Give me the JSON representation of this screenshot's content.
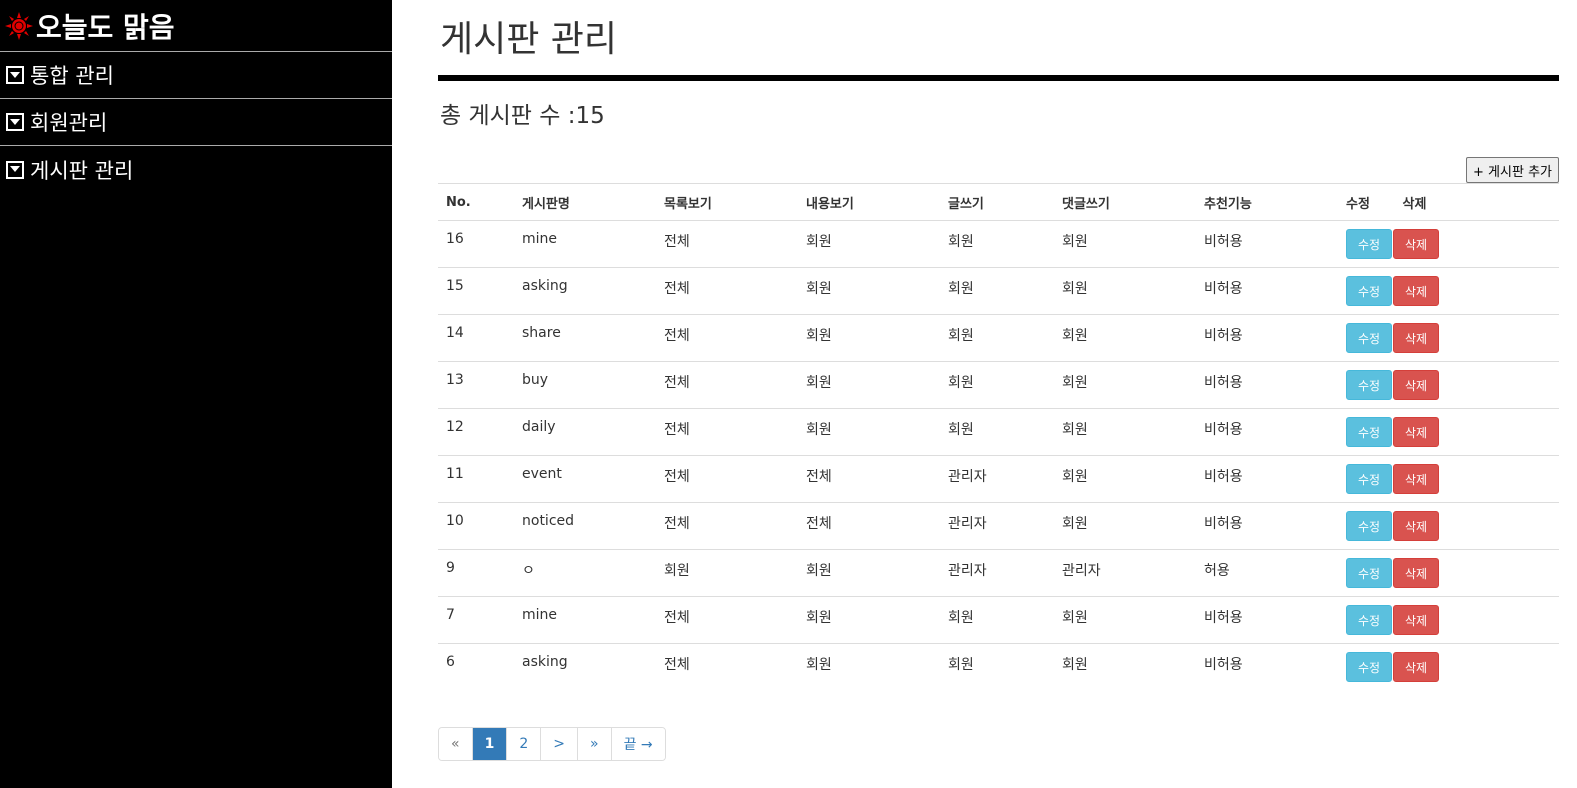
{
  "colors": {
    "sidebar_bg": "#000000",
    "edit_btn": "#5bc0de",
    "delete_btn": "#d9534f",
    "active_page": "#337ab7"
  },
  "brand": {
    "icon": "sun-icon",
    "name": "오늘도 맑음"
  },
  "sidebar": {
    "items": [
      {
        "label": "통합 관리",
        "icon": "caret-down-icon"
      },
      {
        "label": "회원관리",
        "icon": "caret-down-icon"
      },
      {
        "label": "게시판 관리",
        "icon": "caret-down-icon"
      }
    ]
  },
  "main": {
    "title": "게시판 관리",
    "count_label": "총 게시판 수 :15",
    "add_button": "+ 게시판 추가"
  },
  "table": {
    "headers": [
      "No.",
      "게시판명",
      "목록보기",
      "내용보기",
      "글쓰기",
      "댓글쓰기",
      "추천기능",
      "수정",
      "삭제"
    ],
    "edit_label": "수정",
    "delete_label": "삭제",
    "rows": [
      [
        "16",
        "mine",
        "전체",
        "회원",
        "회원",
        "회원",
        "비허용"
      ],
      [
        "15",
        "asking",
        "전체",
        "회원",
        "회원",
        "회원",
        "비허용"
      ],
      [
        "14",
        "share",
        "전체",
        "회원",
        "회원",
        "회원",
        "비허용"
      ],
      [
        "13",
        "buy",
        "전체",
        "회원",
        "회원",
        "회원",
        "비허용"
      ],
      [
        "12",
        "daily",
        "전체",
        "회원",
        "회원",
        "회원",
        "비허용"
      ],
      [
        "11",
        "event",
        "전체",
        "전체",
        "관리자",
        "회원",
        "비허용"
      ],
      [
        "10",
        "noticed",
        "전체",
        "전체",
        "관리자",
        "회원",
        "비허용"
      ],
      [
        "9",
        "ㅇ",
        "회원",
        "회원",
        "관리자",
        "관리자",
        "허용"
      ],
      [
        "7",
        "mine",
        "전체",
        "회원",
        "회원",
        "회원",
        "비허용"
      ],
      [
        "6",
        "asking",
        "전체",
        "회원",
        "회원",
        "회원",
        "비허용"
      ]
    ]
  },
  "pagination": {
    "items": [
      {
        "label": "«",
        "active": false
      },
      {
        "label": "1",
        "active": true
      },
      {
        "label": "2",
        "active": false
      },
      {
        "label": ">",
        "active": false
      },
      {
        "label": "»",
        "active": false
      },
      {
        "label": "끝 →",
        "active": false
      }
    ]
  }
}
